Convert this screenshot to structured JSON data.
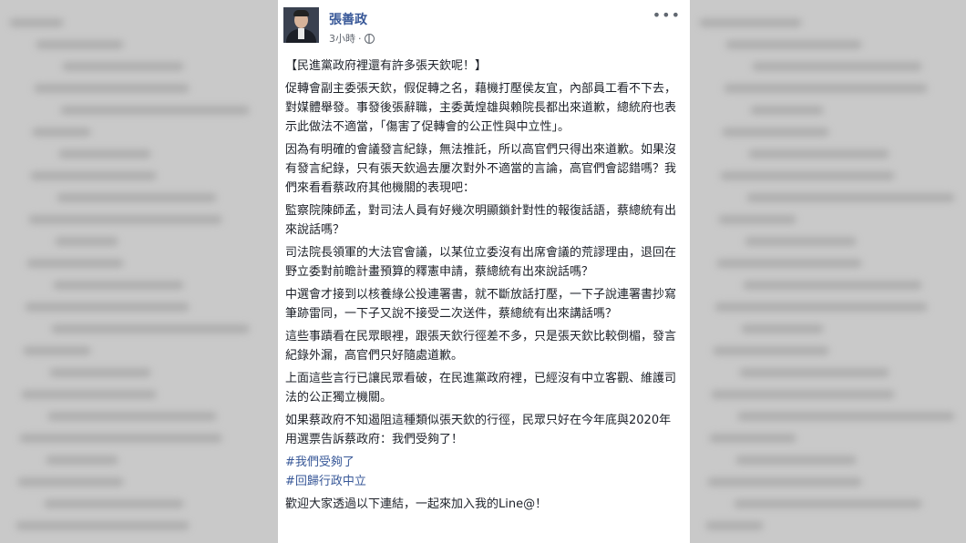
{
  "post": {
    "author": "張善政",
    "time": "3小時",
    "separator": "·",
    "title": "【民進黨政府裡還有許多張天欽呢！】",
    "paragraphs": [
      "促轉會副主委張天欽，假促轉之名，藉機打壓侯友宜，內部員工看不下去，對媒體舉發。事發後張辭職，主委黃煌雄與賴院長都出來道歉，總統府也表示此做法不適當，「傷害了促轉會的公正性與中立性」。",
      "因為有明確的會議發言紀錄，無法推託，所以高官們只得出來道歉。如果沒有發言紀錄，只有張天欽過去屢次對外不適當的言論，高官們會認錯嗎？我們來看看蔡政府其他機關的表現吧：",
      "監察院陳師孟，對司法人員有好幾次明顯鎖針對性的報復話語，蔡總統有出來說話嗎？",
      "司法院長領軍的大法官會議，以某位立委沒有出席會議的荒謬理由，退回在野立委對前瞻計畫預算的釋憲申請，蔡總統有出來說話嗎？",
      "中選會才接到以核養綠公投連署書，就不斷放話打壓，一下子說連署書抄寫筆跡雷同，一下子又說不接受二次送件，蔡總統有出來講話嗎？",
      "這些事蹟看在民眾眼裡，跟張天欽行徑差不多，只是張天欽比較倒楣，發言紀錄外漏，高官們只好隨處道歉。",
      "上面這些言行已讓民眾看破，在民進黨政府裡，已經沒有中立客觀、維護司法的公正獨立機關。",
      "如果蔡政府不知遏阻這種類似張天欽的行徑，民眾只好在今年底與2020年用選票告訴蔡政府：我們受夠了！"
    ],
    "hashtags": [
      "#我們受夠了",
      "#回歸行政中立"
    ],
    "closing": "歡迎大家透過以下連結，一起來加入我的Line@！"
  },
  "icons": {
    "privacy": "globe-icon",
    "options": "more-options-icon"
  },
  "colors": {
    "author_link": "#385898",
    "text": "#1d2129",
    "meta": "#616770",
    "background": "#c9c9c9"
  }
}
